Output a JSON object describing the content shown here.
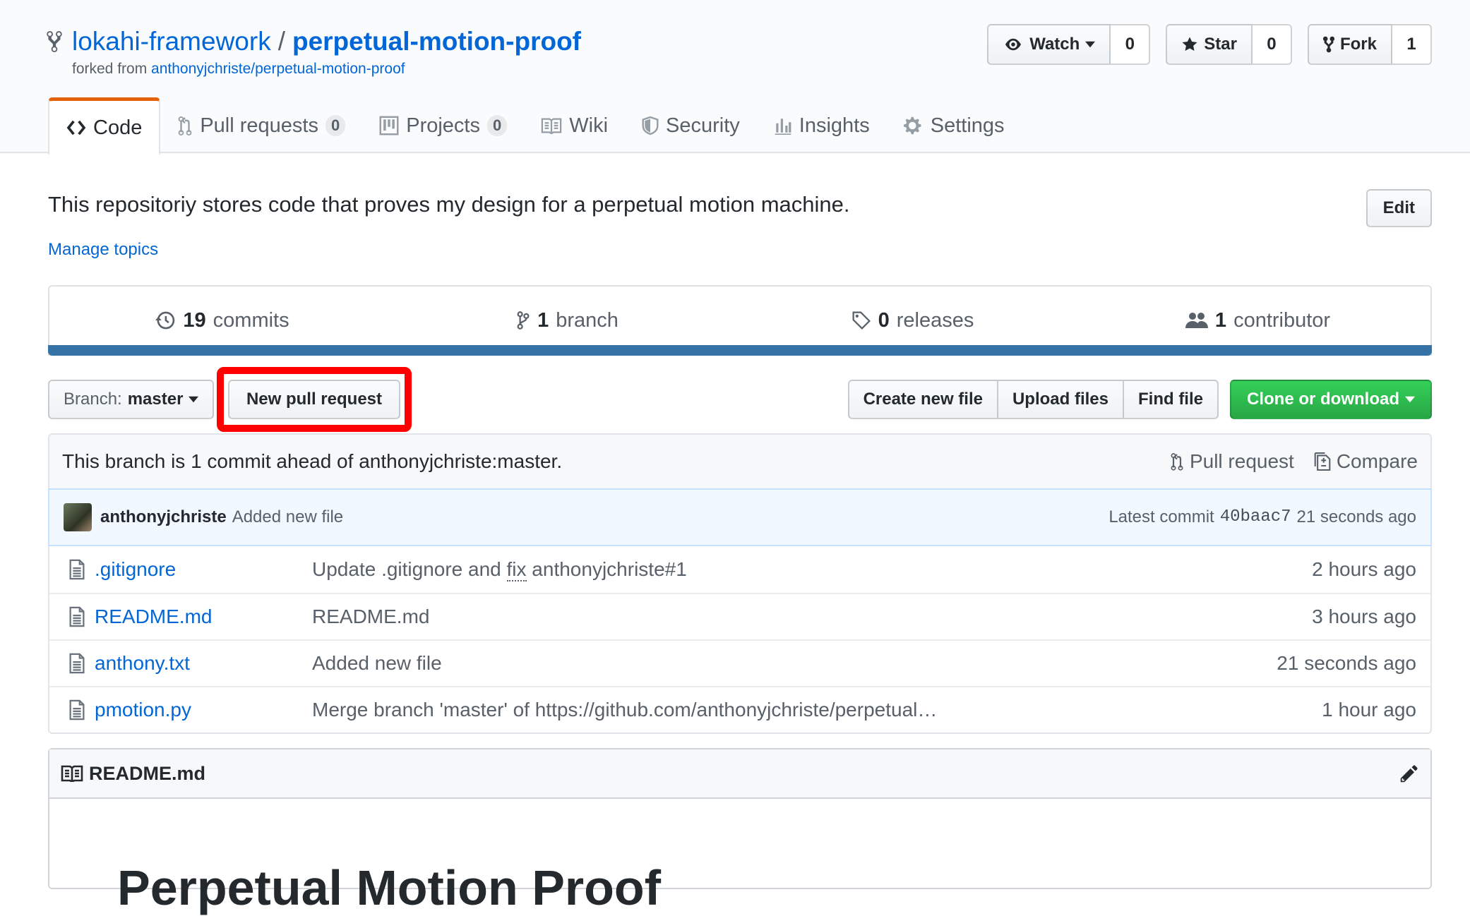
{
  "repo": {
    "owner": "lokahi-framework",
    "separator": "/",
    "name": "perpetual-motion-proof",
    "forked_prefix": "forked from",
    "forked_from": "anthonyjchriste/perpetual-motion-proof"
  },
  "actions": {
    "watch_label": "Watch",
    "watch_count": "0",
    "star_label": "Star",
    "star_count": "0",
    "fork_label": "Fork",
    "fork_count": "1"
  },
  "nav": {
    "code": "Code",
    "pull_requests": "Pull requests",
    "pull_requests_count": "0",
    "projects": "Projects",
    "projects_count": "0",
    "wiki": "Wiki",
    "security": "Security",
    "insights": "Insights",
    "settings": "Settings"
  },
  "about": {
    "description": "This repositoriy stores code that proves my design for a perpetual motion machine.",
    "manage_topics": "Manage topics",
    "edit_label": "Edit"
  },
  "summary": {
    "commits_num": "19",
    "commits_label": "commits",
    "branches_num": "1",
    "branches_label": "branch",
    "releases_num": "0",
    "releases_label": "releases",
    "contributors_num": "1",
    "contributors_label": "contributor",
    "language_color": "#3572A5"
  },
  "filenav": {
    "branch_prefix": "Branch:",
    "branch_name": "master",
    "new_pr": "New pull request",
    "create_file": "Create new file",
    "upload_files": "Upload files",
    "find_file": "Find file",
    "clone": "Clone or download"
  },
  "branch_info": {
    "text": "This branch is 1 commit ahead of anthonyjchriste:master.",
    "pull_request": "Pull request",
    "compare": "Compare"
  },
  "latest_commit": {
    "author": "anthonyjchriste",
    "message": "Added new file",
    "prefix": "Latest commit",
    "sha": "40baac7",
    "age": "21 seconds ago"
  },
  "files": [
    {
      "name": ".gitignore",
      "message": "Update .gitignore and ",
      "message_ref": "fix",
      "message_suffix": " anthonyjchriste#1",
      "age": "2 hours ago"
    },
    {
      "name": "README.md",
      "message": "README.md",
      "age": "3 hours ago"
    },
    {
      "name": "anthony.txt",
      "message": "Added new file",
      "age": "21 seconds ago"
    },
    {
      "name": "pmotion.py",
      "message": "Merge branch 'master' of https://github.com/anthonyjchriste/perpetual…",
      "age": "1 hour ago"
    }
  ],
  "readme": {
    "title": "README.md",
    "heading": "Perpetual Motion Proof"
  },
  "colors": {
    "link": "#0366d6",
    "highlight": "#ff0000",
    "clone_button": "#28a745",
    "selected_tab_accent": "#e36209"
  }
}
